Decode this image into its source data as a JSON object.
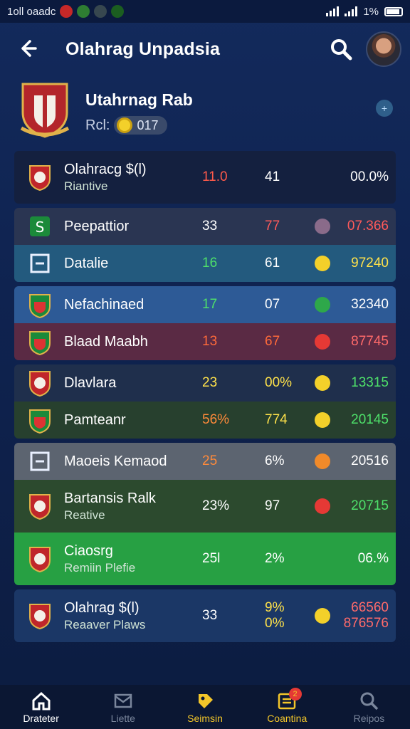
{
  "status_bar": {
    "left_text": "1oll oaadc",
    "right_text": "1%"
  },
  "header": {
    "title": "Olahrag Unpadsia"
  },
  "club": {
    "name": "Utahrnag Rab",
    "sub_label": "Rcl:",
    "pill_value": "017"
  },
  "rows": [
    {
      "name": "Olahracg $(l)",
      "sub": "Riantive",
      "c1": "11.0",
      "c2": "41",
      "c3": "00.0%",
      "c1_color": "#ff5a4a",
      "c2_color": "#ffffff",
      "c3_color": "#ffffff",
      "bg": "#14203f",
      "icon": "crest-icon",
      "ind_color": ""
    },
    {
      "name": "Peepattior",
      "sub": "",
      "c1": "33",
      "c2": "77",
      "c3": "07.366",
      "c1_color": "#ffffff",
      "c2_color": "#ff5a5a",
      "c3_color": "#ff5a5a",
      "bg": "#2a3552",
      "icon": "s-badge-icon",
      "ind_color": "#8a6b8a"
    },
    {
      "name": "Datalie",
      "sub": "",
      "c1": "16",
      "c2": "61",
      "c3": "97240",
      "c1_color": "#4ee06a",
      "c2_color": "#ffffff",
      "c3_color": "#ffe24a",
      "bg": "#235a7e",
      "icon": "square-icon",
      "ind_color": "#f3d02a"
    },
    {
      "name": "Nefachinaed",
      "sub": "",
      "c1": "17",
      "c2": "07",
      "c3": "32340",
      "c1_color": "#4ee06a",
      "c2_color": "#ffffff",
      "c3_color": "#ffffff",
      "bg": "#2d5a96",
      "icon": "shield-icon",
      "ind_color": "#2ea84a"
    },
    {
      "name": "Blaad Maabh",
      "sub": "",
      "c1": "13",
      "c2": "67",
      "c3": "87745",
      "c1_color": "#ff6a3a",
      "c2_color": "#ff6a3a",
      "c3_color": "#ff6a6a",
      "bg": "#5a2a44",
      "icon": "shield-icon",
      "ind_color": "#e53935"
    },
    {
      "name": "Dlavlara",
      "sub": "",
      "c1": "23",
      "c2": "00%",
      "c3": "13315",
      "c1_color": "#ffe24a",
      "c2_color": "#ffe24a",
      "c3_color": "#4ee06a",
      "bg": "#1f2f4c",
      "icon": "crest-icon",
      "ind_color": "#f3d02a"
    },
    {
      "name": "Pamteanr",
      "sub": "",
      "c1": "56%",
      "c2": "774",
      "c3": "20145",
      "c1_color": "#ff8a3a",
      "c2_color": "#ffe24a",
      "c3_color": "#4ee06a",
      "bg": "#27402e",
      "icon": "shield-icon",
      "ind_color": "#f3d02a"
    },
    {
      "name": "Maoeis Kemaod",
      "sub": "",
      "c1": "25",
      "c2": "6%",
      "c3": "20516",
      "c1_color": "#ff8a3a",
      "c2_color": "#ffffff",
      "c3_color": "#ffffff",
      "bg": "#5c6470",
      "icon": "square-icon",
      "ind_color": "#f08a2a"
    },
    {
      "name": "Bartansis Ralk",
      "sub": "Reative",
      "c1": "23%",
      "c2": "97",
      "c3": "20715",
      "c1_color": "#ffffff",
      "c2_color": "#ffffff",
      "c3_color": "#4ee06a",
      "bg": "#2c4a2e",
      "icon": "crest-icon",
      "ind_color": "#e53935"
    },
    {
      "name": "Ciaosrg",
      "sub": "Remiin Plefie",
      "c1": "25l",
      "c2": "2%",
      "c3": "06.%",
      "c1_color": "#ffffff",
      "c2_color": "#ffffff",
      "c3_color": "#ffffff",
      "bg": "#27a043",
      "icon": "crest-icon",
      "ind_color": ""
    },
    {
      "name": "Olahrag $(l)",
      "sub": "Reaaver Plaws",
      "c1": "33",
      "c2": "9% 0%",
      "c3": "66560 876576",
      "c1_color": "#ffffff",
      "c2_color": "#ffe24a",
      "c3_color": "#ff6a6a",
      "bg": "#1b3766",
      "icon": "crest-icon",
      "ind_color": "#f3d02a"
    }
  ],
  "nav": [
    {
      "label": "Drateter",
      "icon": "home-icon",
      "color": "#ffffff"
    },
    {
      "label": "Liette",
      "icon": "mail-icon",
      "color": "#7a869c"
    },
    {
      "label": "Seimsin",
      "icon": "tag-icon",
      "color": "#f3c62a"
    },
    {
      "label": "Coantina",
      "icon": "inbox-icon",
      "color": "#f3c62a"
    },
    {
      "label": "Reipos",
      "icon": "search-icon",
      "color": "#7a869c"
    }
  ],
  "nav_badge": "2"
}
